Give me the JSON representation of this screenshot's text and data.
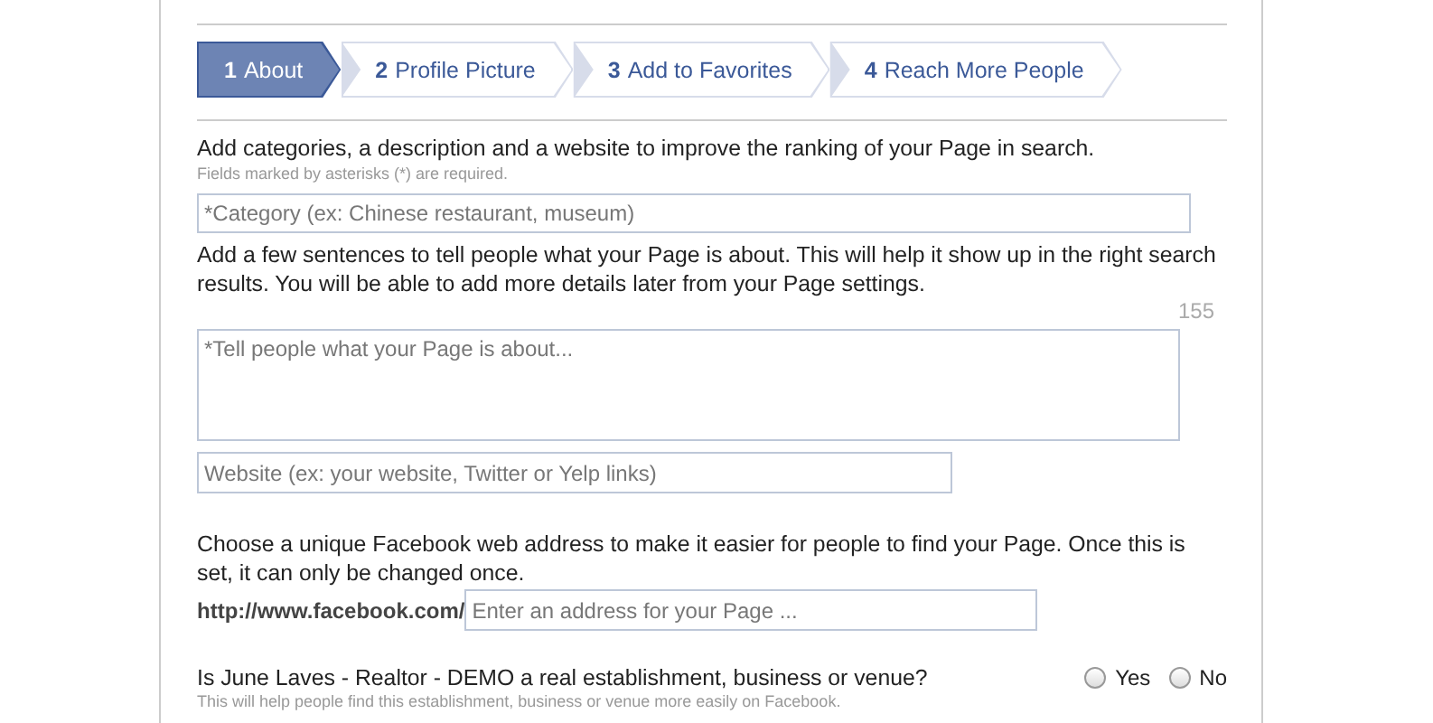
{
  "steps": [
    {
      "number": "1",
      "label": "About",
      "selected": true
    },
    {
      "number": "2",
      "label": "Profile Picture",
      "selected": false
    },
    {
      "number": "3",
      "label": "Add to Favorites",
      "selected": false
    },
    {
      "number": "4",
      "label": "Reach More People",
      "selected": false
    }
  ],
  "intro": "Add categories, a description and a website to improve the ranking of your Page in search.",
  "required_note": "Fields marked by asterisks (*) are required.",
  "category_field": {
    "placeholder": "*Category (ex: Chinese restaurant, museum)"
  },
  "description_help": "Add a few sentences to tell people what your Page is about. This will help it show up in the right search results. You will be able to add more details later from your Page settings.",
  "char_count": "155",
  "description_field": {
    "placeholder": "*Tell people what your Page is about..."
  },
  "website_field": {
    "placeholder": "Website (ex: your website, Twitter or Yelp links)"
  },
  "address_help": "Choose a unique Facebook web address to make it easier for people to find your Page. Once this is set, it can only be changed once.",
  "address_prefix": "http://www.facebook.com/",
  "address_field": {
    "placeholder": "Enter an address for your Page ..."
  },
  "question": "Is June Laves - Realtor - DEMO a real establishment, business or venue?",
  "options": [
    {
      "label": "Yes",
      "selected": false
    },
    {
      "label": "No",
      "selected": false
    }
  ],
  "question_note": "This will help people find this establishment, business or venue more easily on Facebook."
}
